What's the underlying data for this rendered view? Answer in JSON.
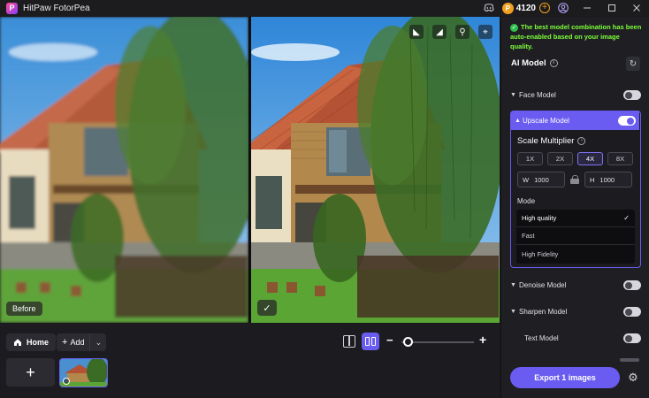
{
  "app": {
    "title": "HitPaw FotorPea",
    "credits": "4120",
    "icons": [
      "discord-icon",
      "coin-icon",
      "add-credits-icon",
      "account-icon",
      "minimize-icon",
      "maximize-icon",
      "close-icon"
    ]
  },
  "compare": {
    "before_label": "Before",
    "after_badge": "✓",
    "tools": [
      "compare-icon",
      "split-icon",
      "zoom-icon",
      "crop-icon"
    ]
  },
  "bottom": {
    "home_label": "Home",
    "add_label": "Add",
    "zoom_level": 0.05
  },
  "panel": {
    "notice": "The best model combination has been auto-enabled based on your image quality.",
    "ai_model_title": "AI Model",
    "models": {
      "face": {
        "label": "Face Model",
        "enabled": false
      },
      "upscale": {
        "label": "Upscale Model",
        "enabled": true
      },
      "denoise": {
        "label": "Denoise Model",
        "enabled": false
      },
      "sharpen": {
        "label": "Sharpen Model",
        "enabled": false
      },
      "text": {
        "label": "Text Model",
        "enabled": false
      }
    },
    "upscale": {
      "scale_title": "Scale Multiplier",
      "multipliers": [
        "1X",
        "2X",
        "4X",
        "8X"
      ],
      "selected_multiplier": "4X",
      "width_label": "W",
      "width_value": "1000",
      "height_label": "H",
      "height_value": "1000",
      "mode_label": "Mode",
      "modes": [
        "High quality",
        "Fast",
        "High Fidelity"
      ],
      "selected_mode": "High quality"
    },
    "export_label": "Export 1 images"
  },
  "colors": {
    "accent": "#6a5cf0",
    "notice": "#7dff3a",
    "background": "#1a1a1d"
  }
}
